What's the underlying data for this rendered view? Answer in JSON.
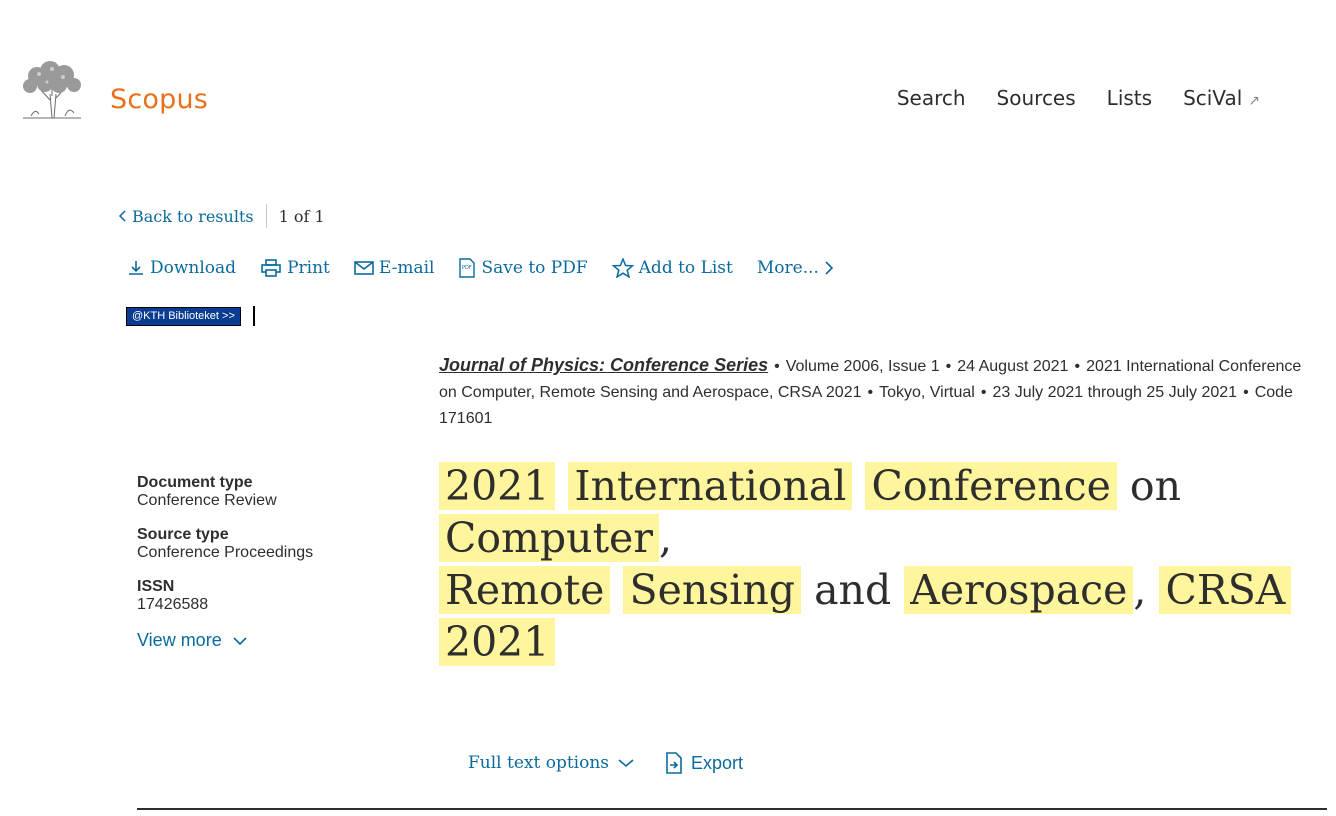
{
  "brand": {
    "name": "Scopus"
  },
  "nav": {
    "search": "Search",
    "sources": "Sources",
    "lists": "Lists",
    "scival": "SciVal",
    "scival_icon": "external-arrow-icon"
  },
  "back": {
    "label": "Back to results",
    "pager": "1 of 1"
  },
  "toolbar": {
    "download": "Download",
    "print": "Print",
    "email": "E-mail",
    "save_pdf": "Save to PDF",
    "add_list": "Add to List",
    "more": "More..."
  },
  "kth": {
    "label": "@KTH Biblioteket >>"
  },
  "meta": {
    "journal": "Journal of Physics: Conference Series",
    "volume": "Volume 2006, Issue 1",
    "date": "24 August 2021",
    "conference": "2021 International Conference on Computer, Remote Sensing and Aerospace, CRSA 2021",
    "location": "Tokyo, Virtual",
    "dates": "23 July 2021 through 25 July 2021",
    "code": "Code 171601"
  },
  "side": {
    "doc_type_label": "Document type",
    "doc_type_value": "Conference Review",
    "source_type_label": "Source type",
    "source_type_value": "Conference Proceedings",
    "issn_label": "ISSN",
    "issn_value": "17426588",
    "view_more": "View more"
  },
  "title": {
    "w1": "2021",
    "w2": "International",
    "w3": "Conference",
    "w4": "on",
    "w5": "Computer",
    "c1": ",",
    "w6": "Remote",
    "w7": "Sensing",
    "w8": "and",
    "w9": "Aerospace",
    "c2": ",",
    "w10": "CRSA",
    "w11": "2021"
  },
  "actions": {
    "full_text": "Full text options",
    "export": "Export"
  },
  "colors": {
    "brand": "#e9711c",
    "link": "#0b6a9d",
    "highlight": "#fff59d",
    "kth_bg": "#0a3d91"
  }
}
